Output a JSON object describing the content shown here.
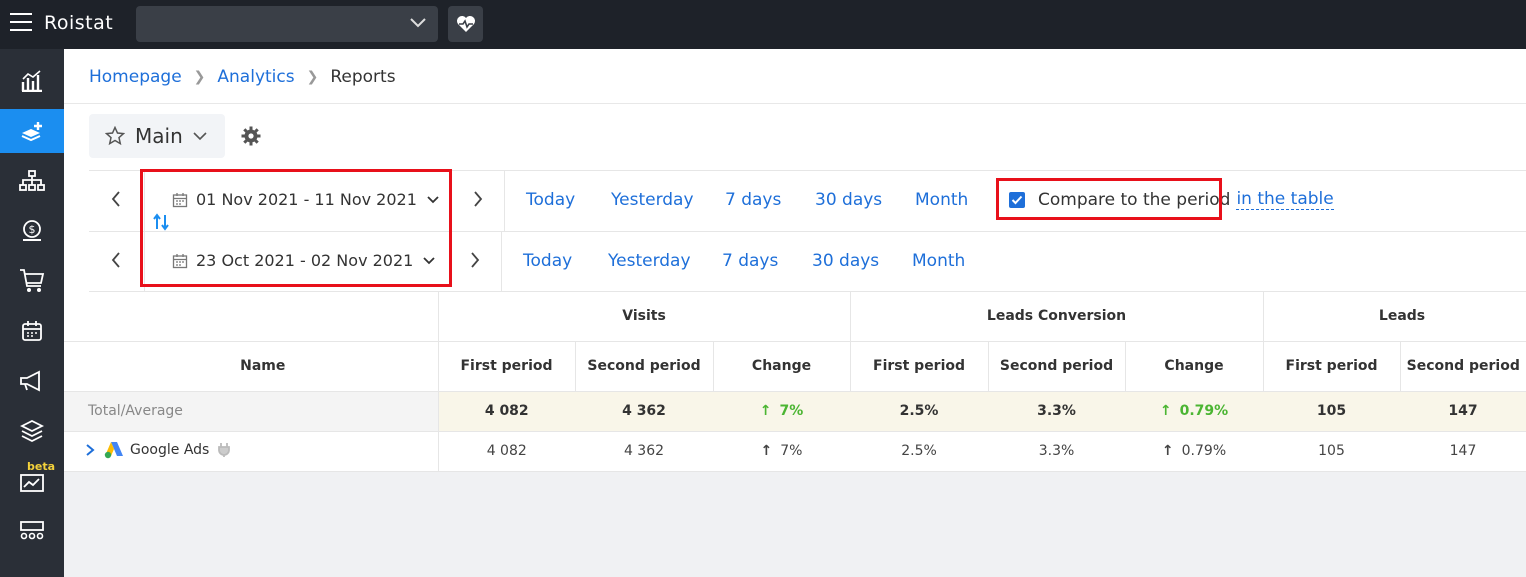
{
  "app": {
    "logo": "Roistat"
  },
  "breadcrumb": {
    "home": "Homepage",
    "analytics": "Analytics",
    "current": "Reports"
  },
  "report": {
    "name": "Main"
  },
  "period1": {
    "range": "01 Nov 2021 - 11 Nov 2021",
    "presets": [
      "Today",
      "Yesterday",
      "7 days",
      "30 days",
      "Month"
    ]
  },
  "period2": {
    "range": "23 Oct 2021 - 02 Nov 2021",
    "presets": [
      "Today",
      "Yesterday",
      "7 days",
      "30 days",
      "Month"
    ]
  },
  "compare": {
    "label": "Compare to the period",
    "link": "in the table",
    "checked": true
  },
  "table": {
    "name_header": "Name",
    "groups": [
      "Visits",
      "Leads Conversion",
      "Leads"
    ],
    "sub": {
      "first": "First period",
      "second": "Second period",
      "change": "Change"
    },
    "total": {
      "name": "Total/Average",
      "visits": [
        "4 082",
        "4 362",
        "7%"
      ],
      "conversion": [
        "2.5%",
        "3.3%",
        "0.79%"
      ],
      "leads": [
        "105",
        "147"
      ]
    },
    "rows": [
      {
        "name": "Google Ads",
        "visits": [
          "4 082",
          "4 362",
          "7%"
        ],
        "conversion": [
          "2.5%",
          "3.3%",
          "0.79%"
        ],
        "leads": [
          "105",
          "147"
        ]
      }
    ]
  },
  "colors": {
    "accent": "#1e6fd9",
    "highlight": "#e8101a",
    "positive": "#4bb532"
  }
}
